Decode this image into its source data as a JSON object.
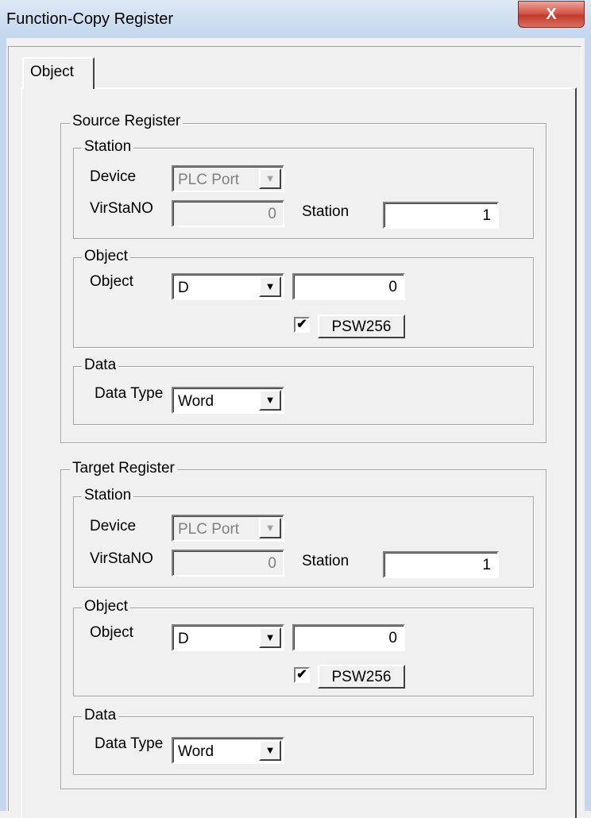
{
  "window": {
    "title": "Function-Copy Register",
    "close_label": "X"
  },
  "tabs": [
    {
      "label": "Object"
    }
  ],
  "source": {
    "title": "Source Register",
    "station_group": "Station",
    "device_label": "Device",
    "device_value": "PLC Port",
    "virsta_label": "VirStaNO",
    "virsta_value": "0",
    "station_label": "Station",
    "station_value": "1",
    "object_group": "Object",
    "object_label": "Object",
    "object_type": "D",
    "object_address": "0",
    "psw_checked": "✔",
    "psw_label": "PSW256",
    "data_group": "Data",
    "data_type_label": "Data Type",
    "data_type_value": "Word"
  },
  "target": {
    "title": "Target Register",
    "station_group": "Station",
    "device_label": "Device",
    "device_value": "PLC Port",
    "virsta_label": "VirStaNO",
    "virsta_value": "0",
    "station_label": "Station",
    "station_value": "1",
    "object_group": "Object",
    "object_label": "Object",
    "object_type": "D",
    "object_address": "0",
    "psw_checked": "✔",
    "psw_label": "PSW256",
    "data_group": "Data",
    "data_type_label": "Data Type",
    "data_type_value": "Word"
  },
  "icons": {
    "dropdown": "chevron-down-icon",
    "close": "close-icon",
    "check": "check-icon"
  },
  "colors": {
    "titlebar": "#c4d7ee",
    "close_button": "#c23a2a",
    "panel": "#f0f0f0"
  }
}
